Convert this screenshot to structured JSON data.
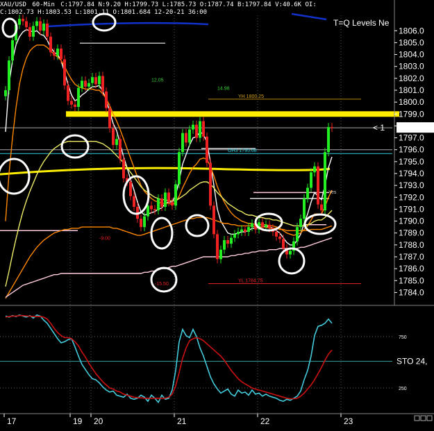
{
  "header": {
    "symbol": "XAU/USD",
    "interval": "60-Min",
    "stats": "C:1797.84  N:9.20  H:1799.73  L:1785.73  O:1787.74  B:1797.84  V:40.6K  OI:",
    "row2": "C:1802.73 H:1803.53 L:1801.11 O:1801.684 12-20-21 36:00",
    "overlay_title": "T=Q Levels Ne"
  },
  "colors": {
    "background": "#000000",
    "bull": "#22ee22",
    "bear": "#ee2222",
    "yellow_level": "#ffee00",
    "cyan": "#33ccdd",
    "orange": "#ff8800",
    "pink": "#ffccdd",
    "blue": "#1133cc",
    "stoch_fast": "#44ccdd",
    "stoch_slow": "#cc1111"
  },
  "chart_data": [
    {
      "type": "line",
      "title": "XAU/USD 60-Min",
      "ylim": [
        1783.5,
        1807.3
      ],
      "y_ticks": [
        1784,
        1785,
        1786,
        1787,
        1788,
        1789,
        1790,
        1791,
        1792,
        1793,
        1794,
        1795,
        1796,
        1797,
        1798,
        1799,
        1800,
        1801,
        1802,
        1803,
        1804,
        1805,
        1806
      ],
      "x_tick_labels": [
        "17",
        "19",
        "20",
        "21",
        "22",
        "23"
      ],
      "x_tick_index": [
        0,
        19,
        25,
        49,
        73,
        97
      ],
      "n_bars": 105,
      "close": [
        1801.0,
        1803.5,
        1805.2,
        1806.5,
        1807.0,
        1806.8,
        1806.3,
        1805.5,
        1806.4,
        1806.8,
        1806.0,
        1806.6,
        1805.5,
        1804.2,
        1803.9,
        1804.5,
        1803.6,
        1801.4,
        1800.1,
        1799.8,
        1799.6,
        1801.2,
        1801.8,
        1801.3,
        1801.6,
        1802.1,
        1801.5,
        1802.2,
        1800.9,
        1799.5,
        1797.8,
        1796.4,
        1796.9,
        1795.2,
        1793.6,
        1793.3,
        1792.1,
        1791.2,
        1790.2,
        1789.5,
        1790.4,
        1791.3,
        1791.0,
        1790.9,
        1791.9,
        1791.2,
        1792.4,
        1791.6,
        1791.3,
        1793.1,
        1795.8,
        1797.4,
        1796.6,
        1797.7,
        1798.1,
        1797.0,
        1798.4,
        1797.1,
        1794.9,
        1791.3,
        1788.9,
        1786.8,
        1787.6,
        1788.4,
        1788.1,
        1788.6,
        1788.9,
        1789.1,
        1789.3,
        1789.1,
        1789.5,
        1789.8,
        1789.3,
        1789.9,
        1789.5,
        1789.7,
        1789.4,
        1789.1,
        1788.7,
        1788.5,
        1787.7,
        1787.2,
        1787.5,
        1788.3,
        1789.5,
        1790.2,
        1791.9,
        1792.8,
        1794.1,
        1794.6,
        1791.4,
        1790.9,
        1795.8,
        1797.9,
        1797.84
      ],
      "series": [
        {
          "name": "",
          "color": "#ffffff",
          "values": [
            1797.5,
            1801.5,
            1803.5,
            1804.8,
            1805.5,
            1805.9,
            1806.1,
            1806.0,
            1805.9,
            1806.0,
            1805.7,
            1805.6,
            1805.2,
            1804.6,
            1804.2,
            1804.0,
            1803.5,
            1802.5,
            1801.5,
            1800.6,
            1800.1,
            1800.3,
            1800.6,
            1800.8,
            1801.1,
            1801.3,
            1801.3,
            1801.4,
            1800.9,
            1800.2,
            1799.2,
            1798.2,
            1797.6,
            1796.5,
            1795.4,
            1794.5,
            1793.5,
            1792.6,
            1791.6,
            1790.8,
            1790.5,
            1790.6,
            1790.7,
            1790.8,
            1791.0,
            1791.1,
            1791.5,
            1791.6,
            1791.6,
            1792.2,
            1793.4,
            1794.8,
            1795.6,
            1796.4,
            1797.0,
            1797.1,
            1797.5,
            1797.3,
            1796.6,
            1795.0,
            1793.0,
            1791.0,
            1790.0,
            1789.5,
            1789.0,
            1788.9,
            1788.9,
            1789.0,
            1789.1,
            1789.1,
            1789.2,
            1789.4,
            1789.4,
            1789.5,
            1789.5,
            1789.6,
            1789.5,
            1789.4,
            1789.2,
            1789.0,
            1788.6,
            1788.2,
            1788.0,
            1788.0,
            1788.4,
            1788.9,
            1789.8,
            1790.6,
            1791.6,
            1792.4,
            1792.1,
            1791.8,
            1793.0,
            1794.5,
            1795.4
          ]
        },
        {
          "name": "",
          "color": "#ff8800",
          "values": [
            1790.0,
            1794.0,
            1797.0,
            1799.5,
            1801.5,
            1802.8,
            1803.7,
            1804.3,
            1804.6,
            1804.8,
            1804.8,
            1804.8,
            1804.6,
            1804.3,
            1804.0,
            1803.8,
            1803.5,
            1803.0,
            1802.4,
            1801.9,
            1801.5,
            1801.3,
            1801.2,
            1801.1,
            1801.1,
            1801.1,
            1801.0,
            1801.0,
            1800.7,
            1800.3,
            1799.7,
            1799.0,
            1798.4,
            1797.7,
            1796.9,
            1796.1,
            1795.3,
            1794.5,
            1793.7,
            1793.0,
            1792.5,
            1792.2,
            1791.9,
            1791.7,
            1791.6,
            1791.5,
            1791.5,
            1791.5,
            1791.4,
            1791.6,
            1792.1,
            1792.8,
            1793.4,
            1794.0,
            1794.5,
            1794.8,
            1795.2,
            1795.3,
            1795.2,
            1794.6,
            1793.8,
            1792.9,
            1792.2,
            1791.6,
            1791.1,
            1790.7,
            1790.4,
            1790.2,
            1790.0,
            1789.9,
            1789.8,
            1789.8,
            1789.7,
            1789.7,
            1789.7,
            1789.7,
            1789.6,
            1789.6,
            1789.5,
            1789.4,
            1789.2,
            1789.0,
            1788.9,
            1788.8,
            1788.9,
            1789.0,
            1789.3,
            1789.6,
            1790.1,
            1790.6,
            1790.6,
            1790.6,
            1791.2,
            1792.0,
            1792.6
          ]
        },
        {
          "name": "",
          "color": "#eeee66",
          "values": [
            1784.5,
            1785.8,
            1787.2,
            1788.5,
            1789.7,
            1790.8,
            1791.7,
            1792.5,
            1793.2,
            1793.9,
            1794.5,
            1795.0,
            1795.4,
            1795.8,
            1796.1,
            1796.3,
            1796.5,
            1796.6,
            1796.7,
            1796.7,
            1796.7,
            1796.7,
            1796.7,
            1796.7,
            1796.7,
            1796.7,
            1796.7,
            1796.6,
            1796.5,
            1796.3,
            1796.1,
            1795.8,
            1795.5,
            1795.2,
            1794.9,
            1794.5,
            1794.1,
            1793.7,
            1793.3,
            1792.9,
            1792.6,
            1792.4,
            1792.2,
            1792.0,
            1791.9,
            1791.8,
            1791.8,
            1791.7,
            1791.7,
            1791.7,
            1791.9,
            1792.1,
            1792.3,
            1792.6,
            1792.8,
            1793.0,
            1793.2,
            1793.3,
            1793.3,
            1793.1,
            1792.8,
            1792.4,
            1792.1,
            1791.8,
            1791.5,
            1791.3,
            1791.1,
            1790.9,
            1790.8,
            1790.6,
            1790.5,
            1790.5,
            1790.4,
            1790.3,
            1790.3,
            1790.2,
            1790.2,
            1790.1,
            1790.1,
            1790.0,
            1789.9,
            1789.8,
            1789.7,
            1789.6,
            1789.6,
            1789.6,
            1789.6,
            1789.7,
            1789.8,
            1790.0,
            1790.1,
            1790.1,
            1790.3,
            1790.6,
            1790.9
          ]
        },
        {
          "name": "",
          "color": "#ff8800",
          "values": [
            1783.5,
            1784.0,
            1784.5,
            1785.0,
            1785.5,
            1786.0,
            1786.5,
            1787.0,
            1787.4,
            1787.8,
            1788.1,
            1788.4,
            1788.6,
            1788.8,
            1789.0,
            1789.1,
            1789.2,
            1789.3,
            1789.3,
            1789.4,
            1789.4,
            1789.4,
            1789.5,
            1789.5,
            1789.5,
            1789.5,
            1789.5,
            1789.5,
            1789.5,
            1789.5,
            1789.5,
            1789.4,
            1789.4,
            1789.3,
            1789.2,
            1789.1,
            1789.0,
            1788.9,
            1788.8,
            1788.8,
            1788.9,
            1789.0,
            1789.1,
            1789.2,
            1789.3,
            1789.4,
            1789.5,
            1789.6,
            1789.7,
            1789.8,
            1789.9,
            1790.0,
            1790.1,
            1790.2,
            1790.2,
            1790.3,
            1790.3,
            1790.3,
            1790.3,
            1790.2,
            1790.1,
            1790.0,
            1789.9,
            1789.8,
            1789.8,
            1789.7,
            1789.7,
            1789.6,
            1789.6,
            1789.6,
            1789.6,
            1789.6,
            1789.5,
            1789.5,
            1789.5,
            1789.5,
            1789.4,
            1789.4,
            1789.4,
            1789.3,
            1789.3,
            1789.2,
            1789.2,
            1789.2,
            1789.2,
            1789.2,
            1789.2,
            1789.2,
            1789.3,
            1789.3,
            1789.3,
            1789.3,
            1789.4,
            1789.5,
            1789.6
          ]
        },
        {
          "name": "",
          "color": "#ffccdd",
          "values": [
            1783.6,
            1783.8,
            1784.0,
            1784.2,
            1784.4,
            1784.6,
            1784.7,
            1784.8,
            1784.9,
            1785.0,
            1785.1,
            1785.2,
            1785.3,
            1785.4,
            1785.5,
            1785.5,
            1785.6,
            1785.6,
            1785.6,
            1785.6,
            1785.6,
            1785.6,
            1785.6,
            1785.6,
            1785.6,
            1785.6,
            1785.6,
            1785.6,
            1785.6,
            1785.6,
            1785.6,
            1785.6,
            1785.6,
            1785.6,
            1785.6,
            1785.6,
            1785.6,
            1785.6,
            1785.6,
            1785.6,
            1785.7,
            1785.7,
            1785.8,
            1785.8,
            1785.9,
            1786.0,
            1786.0,
            1786.1,
            1786.2,
            1786.2,
            1786.3,
            1786.4,
            1786.5,
            1786.6,
            1786.7,
            1786.8,
            1786.9,
            1787.0,
            1787.0,
            1787.0,
            1787.0,
            1787.0,
            1787.0,
            1787.0,
            1787.0,
            1787.1,
            1787.1,
            1787.2,
            1787.2,
            1787.3,
            1787.3,
            1787.4,
            1787.4,
            1787.5,
            1787.5,
            1787.5,
            1787.6,
            1787.6,
            1787.6,
            1787.7,
            1787.7,
            1787.7,
            1787.7,
            1787.7,
            1787.7,
            1787.8,
            1787.8,
            1787.9,
            1788.0,
            1788.1,
            1788.2,
            1788.3,
            1788.4,
            1788.5,
            1788.6
          ]
        }
      ],
      "levels": [
        {
          "name": "",
          "value": 1799.0,
          "color": "#ffee00"
        },
        {
          "name": "",
          "value": 1797.84,
          "color": "#aaaaaa"
        },
        {
          "name": "",
          "value": 1796.0,
          "color": "#aaaaaa"
        },
        {
          "name": "",
          "value": 1795.68,
          "color": "#33ccdd"
        },
        {
          "name": "",
          "value": 1794.4,
          "color": "#ffee00"
        }
      ],
      "annotations": [
        {
          "text": "12.05",
          "x": 42,
          "y": 1801.6
        },
        {
          "text": "14.98",
          "x": 61,
          "y": 1800.9
        },
        {
          "text": "YH 1800.25",
          "x": 67,
          "y": 1800.25
        },
        {
          "text": "OH3 1795.68",
          "x": 64,
          "y": 1795.68
        },
        {
          "text": "YL 1784.75",
          "x": 67,
          "y": 1784.75
        },
        {
          "text": "-15.50",
          "x": 43,
          "y": 1784.5
        },
        {
          "text": "-9.00",
          "x": 27,
          "y": 1788.3
        },
        {
          "text": "< 1",
          "x": 98,
          "y": 1797.84
        },
        {
          "text": "1797.84",
          "x": 104,
          "y": 1797.84
        },
        {
          "text": "Yes",
          "x": 93,
          "y": 1792.2
        }
      ]
    },
    {
      "type": "line",
      "title": "STO 24,",
      "ylim": [
        0,
        1000
      ],
      "y_ticks": [
        250,
        750
      ],
      "series": [
        {
          "name": "",
          "color": "#44ccdd",
          "values": [
            950,
            940,
            955,
            945,
            960,
            950,
            940,
            955,
            930,
            960,
            950,
            910,
            880,
            830,
            780,
            730,
            690,
            700,
            720,
            730,
            650,
            560,
            480,
            430,
            380,
            340,
            330,
            300,
            260,
            230,
            210,
            220,
            180,
            170,
            160,
            190,
            150,
            140,
            150,
            180,
            160,
            120,
            180,
            150,
            110,
            180,
            140,
            150,
            230,
            420,
            700,
            820,
            760,
            740,
            820,
            750,
            640,
            560,
            460,
            360,
            290,
            240,
            200,
            220,
            240,
            190,
            170,
            230,
            200,
            210,
            180,
            230,
            190,
            200,
            170,
            190,
            170,
            160,
            150,
            130,
            120,
            140,
            130,
            150,
            170,
            220,
            330,
            420,
            560,
            760,
            850,
            860,
            880,
            920,
            880
          ]
        },
        {
          "name": "",
          "color": "#cc1111",
          "values": [
            940,
            945,
            950,
            950,
            955,
            955,
            950,
            950,
            945,
            945,
            945,
            940,
            920,
            880,
            830,
            790,
            760,
            740,
            740,
            730,
            700,
            660,
            600,
            550,
            490,
            440,
            390,
            350,
            310,
            280,
            250,
            240,
            220,
            210,
            190,
            180,
            170,
            160,
            155,
            155,
            150,
            150,
            150,
            150,
            150,
            150,
            150,
            160,
            190,
            270,
            400,
            540,
            640,
            710,
            730,
            740,
            730,
            710,
            680,
            650,
            620,
            590,
            560,
            520,
            470,
            420,
            380,
            340,
            310,
            290,
            270,
            250,
            240,
            230,
            220,
            210,
            200,
            190,
            180,
            170,
            160,
            150,
            145,
            145,
            150,
            170,
            200,
            240,
            280,
            330,
            390,
            450,
            520,
            580,
            620
          ]
        }
      ]
    }
  ]
}
